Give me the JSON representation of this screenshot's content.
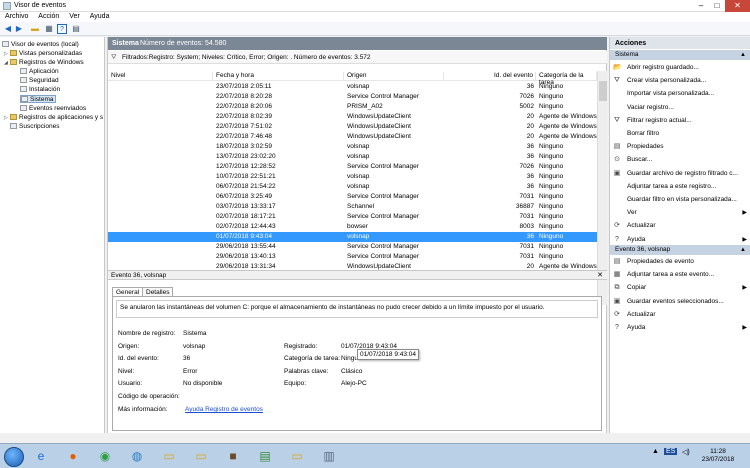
{
  "window": {
    "title": "Visor de eventos"
  },
  "menu": [
    "Archivo",
    "Acción",
    "Ver",
    "Ayuda"
  ],
  "tree": [
    {
      "label": "Visor de eventos (local)",
      "indent": 0
    },
    {
      "label": "Vistas personalizadas",
      "indent": 1
    },
    {
      "label": "Registros de Windows",
      "indent": 1
    },
    {
      "label": "Aplicación",
      "indent": 2
    },
    {
      "label": "Seguridad",
      "indent": 2
    },
    {
      "label": "Instalación",
      "indent": 2
    },
    {
      "label": "Sistema",
      "indent": 2
    },
    {
      "label": "Eventos reenviados",
      "indent": 2
    },
    {
      "label": "Registros de aplicaciones y s",
      "indent": 1
    },
    {
      "label": "Suscripciones",
      "indent": 1
    }
  ],
  "log": {
    "name": "Sistema",
    "count_label": "Número de eventos: 54.580",
    "filter_text": "Filtrados:Registro: System; Niveles: Crítico, Error; Origen: . Número de eventos: 3.572"
  },
  "columns": [
    "Nivel",
    "Fecha y hora",
    "Origen",
    "Id. del evento",
    "Categoría de la tarea"
  ],
  "events": [
    {
      "level": "Error",
      "date": "23/07/2018 2:05:11",
      "source": "volsnap",
      "id": "36",
      "cat": "Ninguno"
    },
    {
      "level": "Error",
      "date": "22/07/2018 8:20:28",
      "source": "Service Control Manager",
      "id": "7026",
      "cat": "Ninguno"
    },
    {
      "level": "Error",
      "date": "22/07/2018 8:20:06",
      "source": "PRISM_A02",
      "id": "5002",
      "cat": "Ninguno"
    },
    {
      "level": "Error",
      "date": "22/07/2018 8:02:39",
      "source": "WindowsUpdateClient",
      "id": "20",
      "cat": "Agente de Windows Update"
    },
    {
      "level": "Error",
      "date": "22/07/2018 7:51:02",
      "source": "WindowsUpdateClient",
      "id": "20",
      "cat": "Agente de Windows Update"
    },
    {
      "level": "Error",
      "date": "22/07/2018 7:46:48",
      "source": "WindowsUpdateClient",
      "id": "20",
      "cat": "Agente de Windows Update"
    },
    {
      "level": "Error",
      "date": "18/07/2018 3:02:59",
      "source": "volsnap",
      "id": "36",
      "cat": "Ninguno"
    },
    {
      "level": "Error",
      "date": "13/07/2018 23:02:20",
      "source": "volsnap",
      "id": "36",
      "cat": "Ninguno"
    },
    {
      "level": "Error",
      "date": "12/07/2018 12:28:52",
      "source": "Service Control Manager",
      "id": "7026",
      "cat": "Ninguno"
    },
    {
      "level": "Error",
      "date": "10/07/2018 22:51:21",
      "source": "volsnap",
      "id": "36",
      "cat": "Ninguno"
    },
    {
      "level": "Error",
      "date": "06/07/2018 21:54:22",
      "source": "volsnap",
      "id": "36",
      "cat": "Ninguno"
    },
    {
      "level": "Error",
      "date": "06/07/2018 3:25:49",
      "source": "Service Control Manager",
      "id": "7031",
      "cat": "Ninguno"
    },
    {
      "level": "Error",
      "date": "03/07/2018 13:33:17",
      "source": "Schannel",
      "id": "36887",
      "cat": "Ninguno"
    },
    {
      "level": "Error",
      "date": "02/07/2018 18:17:21",
      "source": "Service Control Manager",
      "id": "7031",
      "cat": "Ninguno"
    },
    {
      "level": "Error",
      "date": "02/07/2018 12:44:43",
      "source": "bowser",
      "id": "8003",
      "cat": "Ninguno"
    },
    {
      "level": "Error",
      "date": "01/07/2018 9:43:04",
      "source": "volsnap",
      "id": "36",
      "cat": "Ninguno",
      "selected": true
    },
    {
      "level": "Error",
      "date": "29/06/2018 13:55:44",
      "source": "Service Control Manager",
      "id": "7031",
      "cat": "Ninguno"
    },
    {
      "level": "Error",
      "date": "29/06/2018 13:40:13",
      "source": "Service Control Manager",
      "id": "7031",
      "cat": "Ninguno"
    },
    {
      "level": "Error",
      "date": "29/06/2018 13:31:34",
      "source": "WindowsUpdateClient",
      "id": "20",
      "cat": "Agente de Windows Update"
    }
  ],
  "detail": {
    "header": "Evento 36, volsnap",
    "tabs": [
      "General",
      "Detalles"
    ],
    "message": "Se anularon las instantáneas del volumen C: porque el almacenamiento de instantáneas no pudo crecer debido a un límite impuesto por el usuario.",
    "labels": {
      "log_name": "Nombre de registro:",
      "source": "Origen:",
      "event_id": "Id. del evento:",
      "level": "Nivel:",
      "user": "Usuario:",
      "opcode": "Código de operación:",
      "more_info": "Más información:",
      "logged": "Registrado:",
      "task_category": "Categoría de tarea:",
      "keywords": "Palabras clave:",
      "computer": "Equipo:"
    },
    "values": {
      "log_name": "Sistema",
      "source": "volsnap",
      "event_id": "36",
      "level": "Error",
      "user": "No disponible",
      "opcode": "",
      "more_info": "Ayuda Registro de eventos",
      "logged": "01/07/2018 9:43:04",
      "task_category": "Ninguno",
      "keywords": "Clásico",
      "computer": "Alejo-PC"
    },
    "tooltip": "01/07/2018 9:43:04"
  },
  "actions": {
    "title": "Acciones",
    "section1": "Sistema",
    "items1": [
      {
        "label": "Abrir registro guardado...",
        "icon": "open-folder-icon",
        "glyph": "📂"
      },
      {
        "label": "Crear vista personalizada...",
        "icon": "filter-create-icon",
        "glyph": "⛛"
      },
      {
        "label": "Importar vista personalizada...",
        "icon": "",
        "glyph": ""
      },
      {
        "label": "Vaciar registro...",
        "icon": "",
        "glyph": ""
      },
      {
        "label": "Filtrar registro actual...",
        "icon": "filter-icon",
        "glyph": "⛛"
      },
      {
        "label": "Borrar filtro",
        "icon": "",
        "glyph": ""
      },
      {
        "label": "Propiedades",
        "icon": "properties-icon",
        "glyph": "▤"
      },
      {
        "label": "Buscar...",
        "icon": "binoculars-icon",
        "glyph": "⊙"
      },
      {
        "label": "Guardar archivo de registro filtrado c...",
        "icon": "save-icon",
        "glyph": "▣"
      },
      {
        "label": "Adjuntar tarea a este registro...",
        "icon": "",
        "glyph": ""
      },
      {
        "label": "Guardar filtro en vista personalizada...",
        "icon": "",
        "glyph": ""
      },
      {
        "label": "Ver",
        "icon": "",
        "glyph": "",
        "submenu": true
      },
      {
        "label": "Actualizar",
        "icon": "refresh-icon",
        "glyph": "⟳"
      },
      {
        "label": "Ayuda",
        "icon": "help-icon",
        "glyph": "?",
        "submenu": true
      }
    ],
    "section2": "Evento 36, volsnap",
    "items2": [
      {
        "label": "Propiedades de evento",
        "icon": "properties-icon",
        "glyph": "▤"
      },
      {
        "label": "Adjuntar tarea a este evento...",
        "icon": "task-icon",
        "glyph": "▦"
      },
      {
        "label": "Copiar",
        "icon": "copy-icon",
        "glyph": "⧉",
        "submenu": true
      },
      {
        "label": "Guardar eventos seleccionados...",
        "icon": "save-icon",
        "glyph": "▣"
      },
      {
        "label": "Actualizar",
        "icon": "refresh-icon",
        "glyph": "⟳"
      },
      {
        "label": "Ayuda",
        "icon": "help-icon",
        "glyph": "?",
        "submenu": true
      }
    ]
  },
  "taskbar": {
    "apps": [
      {
        "name": "ie-icon",
        "glyph": "e",
        "color": "#1f6fd1"
      },
      {
        "name": "firefox-icon",
        "glyph": "●",
        "color": "#e66000"
      },
      {
        "name": "chrome-icon",
        "glyph": "◉",
        "color": "#2f9e44"
      },
      {
        "name": "network-icon",
        "glyph": "◍",
        "color": "#2a7bc4"
      },
      {
        "name": "folder-icon",
        "glyph": "▭",
        "color": "#d9a520"
      },
      {
        "name": "explorer-icon",
        "glyph": "▭",
        "color": "#d9a520"
      },
      {
        "name": "minecraft-icon",
        "glyph": "■",
        "color": "#6b4b2a"
      },
      {
        "name": "notepad-icon",
        "glyph": "▤",
        "color": "#3a8a3a"
      },
      {
        "name": "folder-icon-2",
        "glyph": "▭",
        "color": "#d9a520"
      },
      {
        "name": "event-viewer-icon",
        "glyph": "▥",
        "color": "#5a6a80"
      }
    ],
    "tray": "ES",
    "time": "11:28",
    "date": "23/07/2018"
  }
}
